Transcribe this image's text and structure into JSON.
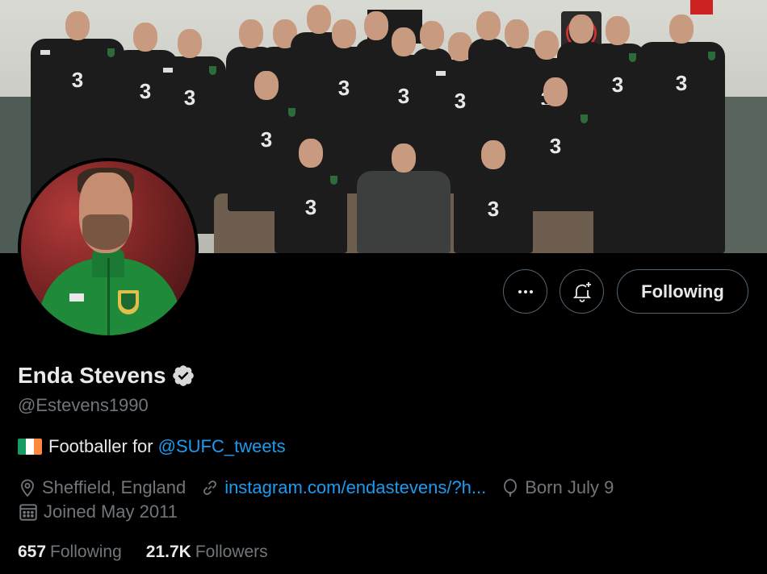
{
  "profile": {
    "name": "Enda Stevens",
    "handle": "@Estevens1990",
    "verified": true,
    "bio_text": "Footballer for",
    "bio_mention": "@SUFC_tweets",
    "bio_flag": "ireland-flag",
    "location": "Sheffield, England",
    "website": "instagram.com/endastevens/?h...",
    "birthday": "Born July 9",
    "joined": "Joined May 2011"
  },
  "actions": {
    "more_icon": "more-icon",
    "notify_icon": "bell-plus-icon",
    "follow_label": "Following"
  },
  "stats": {
    "following_count": "657",
    "following_label": "Following",
    "followers_count": "21.7K",
    "followers_label": "Followers"
  },
  "banner": {
    "jersey_number": "3"
  },
  "colors": {
    "background": "#000000",
    "link": "#1d9bf0",
    "secondary_text": "#71767b",
    "border": "#536471",
    "flag_green": "#169b62",
    "flag_white": "#ffffff",
    "flag_orange": "#ff883e"
  }
}
